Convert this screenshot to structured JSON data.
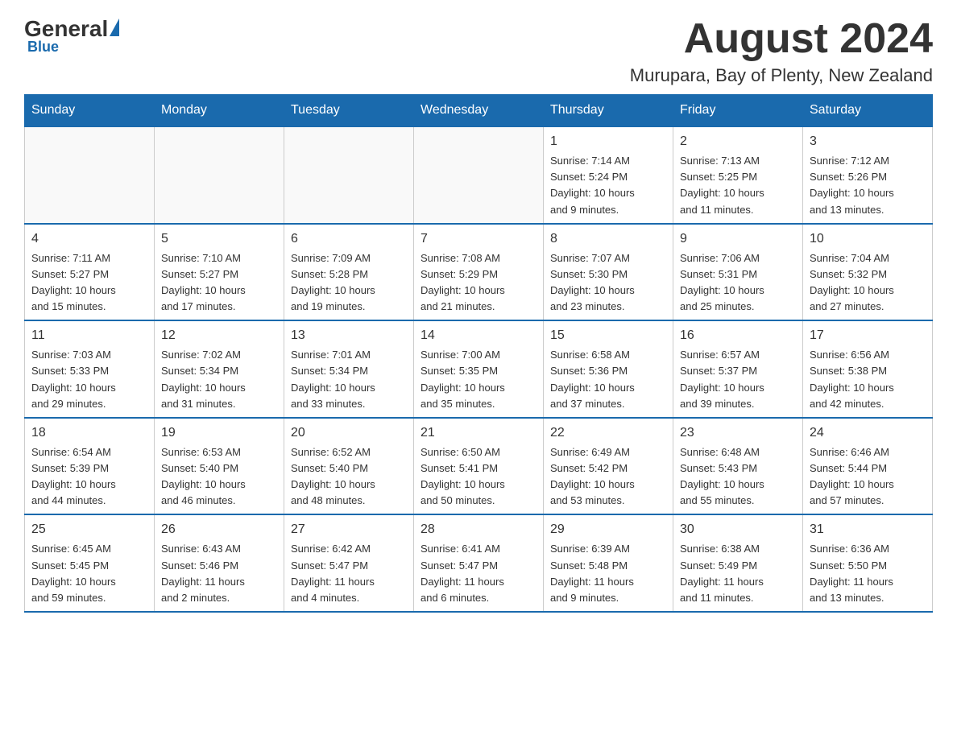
{
  "logo": {
    "general": "General",
    "blue": "Blue"
  },
  "header": {
    "month": "August 2024",
    "location": "Murupara, Bay of Plenty, New Zealand"
  },
  "weekdays": [
    "Sunday",
    "Monday",
    "Tuesday",
    "Wednesday",
    "Thursday",
    "Friday",
    "Saturday"
  ],
  "weeks": [
    [
      {
        "day": "",
        "info": ""
      },
      {
        "day": "",
        "info": ""
      },
      {
        "day": "",
        "info": ""
      },
      {
        "day": "",
        "info": ""
      },
      {
        "day": "1",
        "info": "Sunrise: 7:14 AM\nSunset: 5:24 PM\nDaylight: 10 hours\nand 9 minutes."
      },
      {
        "day": "2",
        "info": "Sunrise: 7:13 AM\nSunset: 5:25 PM\nDaylight: 10 hours\nand 11 minutes."
      },
      {
        "day": "3",
        "info": "Sunrise: 7:12 AM\nSunset: 5:26 PM\nDaylight: 10 hours\nand 13 minutes."
      }
    ],
    [
      {
        "day": "4",
        "info": "Sunrise: 7:11 AM\nSunset: 5:27 PM\nDaylight: 10 hours\nand 15 minutes."
      },
      {
        "day": "5",
        "info": "Sunrise: 7:10 AM\nSunset: 5:27 PM\nDaylight: 10 hours\nand 17 minutes."
      },
      {
        "day": "6",
        "info": "Sunrise: 7:09 AM\nSunset: 5:28 PM\nDaylight: 10 hours\nand 19 minutes."
      },
      {
        "day": "7",
        "info": "Sunrise: 7:08 AM\nSunset: 5:29 PM\nDaylight: 10 hours\nand 21 minutes."
      },
      {
        "day": "8",
        "info": "Sunrise: 7:07 AM\nSunset: 5:30 PM\nDaylight: 10 hours\nand 23 minutes."
      },
      {
        "day": "9",
        "info": "Sunrise: 7:06 AM\nSunset: 5:31 PM\nDaylight: 10 hours\nand 25 minutes."
      },
      {
        "day": "10",
        "info": "Sunrise: 7:04 AM\nSunset: 5:32 PM\nDaylight: 10 hours\nand 27 minutes."
      }
    ],
    [
      {
        "day": "11",
        "info": "Sunrise: 7:03 AM\nSunset: 5:33 PM\nDaylight: 10 hours\nand 29 minutes."
      },
      {
        "day": "12",
        "info": "Sunrise: 7:02 AM\nSunset: 5:34 PM\nDaylight: 10 hours\nand 31 minutes."
      },
      {
        "day": "13",
        "info": "Sunrise: 7:01 AM\nSunset: 5:34 PM\nDaylight: 10 hours\nand 33 minutes."
      },
      {
        "day": "14",
        "info": "Sunrise: 7:00 AM\nSunset: 5:35 PM\nDaylight: 10 hours\nand 35 minutes."
      },
      {
        "day": "15",
        "info": "Sunrise: 6:58 AM\nSunset: 5:36 PM\nDaylight: 10 hours\nand 37 minutes."
      },
      {
        "day": "16",
        "info": "Sunrise: 6:57 AM\nSunset: 5:37 PM\nDaylight: 10 hours\nand 39 minutes."
      },
      {
        "day": "17",
        "info": "Sunrise: 6:56 AM\nSunset: 5:38 PM\nDaylight: 10 hours\nand 42 minutes."
      }
    ],
    [
      {
        "day": "18",
        "info": "Sunrise: 6:54 AM\nSunset: 5:39 PM\nDaylight: 10 hours\nand 44 minutes."
      },
      {
        "day": "19",
        "info": "Sunrise: 6:53 AM\nSunset: 5:40 PM\nDaylight: 10 hours\nand 46 minutes."
      },
      {
        "day": "20",
        "info": "Sunrise: 6:52 AM\nSunset: 5:40 PM\nDaylight: 10 hours\nand 48 minutes."
      },
      {
        "day": "21",
        "info": "Sunrise: 6:50 AM\nSunset: 5:41 PM\nDaylight: 10 hours\nand 50 minutes."
      },
      {
        "day": "22",
        "info": "Sunrise: 6:49 AM\nSunset: 5:42 PM\nDaylight: 10 hours\nand 53 minutes."
      },
      {
        "day": "23",
        "info": "Sunrise: 6:48 AM\nSunset: 5:43 PM\nDaylight: 10 hours\nand 55 minutes."
      },
      {
        "day": "24",
        "info": "Sunrise: 6:46 AM\nSunset: 5:44 PM\nDaylight: 10 hours\nand 57 minutes."
      }
    ],
    [
      {
        "day": "25",
        "info": "Sunrise: 6:45 AM\nSunset: 5:45 PM\nDaylight: 10 hours\nand 59 minutes."
      },
      {
        "day": "26",
        "info": "Sunrise: 6:43 AM\nSunset: 5:46 PM\nDaylight: 11 hours\nand 2 minutes."
      },
      {
        "day": "27",
        "info": "Sunrise: 6:42 AM\nSunset: 5:47 PM\nDaylight: 11 hours\nand 4 minutes."
      },
      {
        "day": "28",
        "info": "Sunrise: 6:41 AM\nSunset: 5:47 PM\nDaylight: 11 hours\nand 6 minutes."
      },
      {
        "day": "29",
        "info": "Sunrise: 6:39 AM\nSunset: 5:48 PM\nDaylight: 11 hours\nand 9 minutes."
      },
      {
        "day": "30",
        "info": "Sunrise: 6:38 AM\nSunset: 5:49 PM\nDaylight: 11 hours\nand 11 minutes."
      },
      {
        "day": "31",
        "info": "Sunrise: 6:36 AM\nSunset: 5:50 PM\nDaylight: 11 hours\nand 13 minutes."
      }
    ]
  ]
}
